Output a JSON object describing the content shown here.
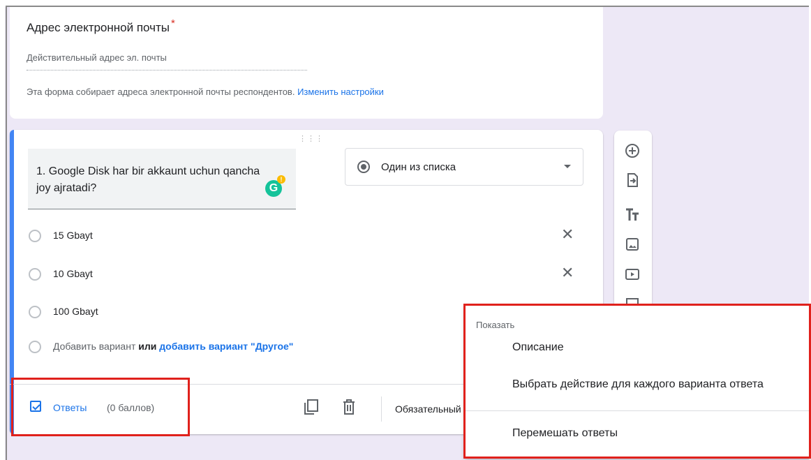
{
  "email_card": {
    "title": "Адрес электронной почты",
    "required_mark": "*",
    "placeholder": "Действительный адрес эл. почты",
    "collect_note": "Эта форма собирает адреса электронной почты респондентов.",
    "change_settings_link": "Изменить настройки"
  },
  "question": {
    "drag_handle": "⋮⋮⋮",
    "text": "1. Google Disk har bir akkaunt uchun qancha joy ajratadi?",
    "type_label": "Один из списка",
    "options": [
      {
        "label": "15 Gbayt"
      },
      {
        "label": "10 Gbayt"
      },
      {
        "label": "100 Gbayt"
      }
    ],
    "remove_icon": "✕",
    "add_option": "Добавить вариант",
    "or": "или",
    "add_other": "добавить вариант \"Другое\""
  },
  "footer": {
    "answers_label": "Ответы",
    "score_label": "(0 баллов)",
    "required_label": "Обязательный"
  },
  "context_menu": {
    "header": "Показать",
    "items": [
      "Описание",
      "Выбрать действие для каждого варианта ответа",
      "Перемешать ответы"
    ]
  },
  "sidebar_icons": [
    "add-question-icon",
    "import-questions-icon",
    "add-title-icon",
    "add-image-icon",
    "add-video-icon",
    "add-section-icon"
  ],
  "colors": {
    "accent": "#1a73e8",
    "highlight_box": "#e0211c",
    "background": "#ede8f6"
  }
}
